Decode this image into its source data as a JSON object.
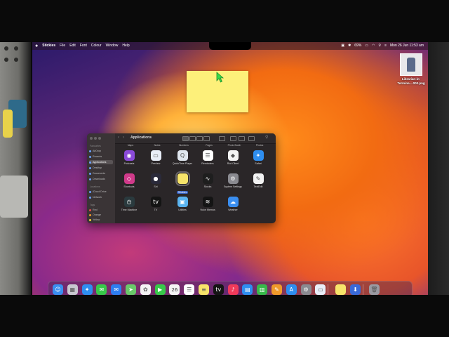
{
  "menubar": {
    "app_name": "Stickies",
    "menus": [
      "File",
      "Edit",
      "Font",
      "Colour",
      "Window",
      "Help"
    ],
    "battery": "69%",
    "datetime": "Mon 26 Jun  11:53 am"
  },
  "desktop_file": {
    "name": "Librarian-in-Termina....000.png"
  },
  "finder": {
    "title": "Applications",
    "sidebar": {
      "favourites_heading": "Favourites",
      "favourites": [
        "AirDrop",
        "Recents",
        "Applications",
        "Desktop",
        "Documents",
        "Downloads"
      ],
      "locations_heading": "Locations",
      "locations": [
        "iCloud Drive",
        "Network"
      ],
      "tags_heading": "Tags",
      "tags": [
        "Red",
        "Orange",
        "Yellow"
      ]
    },
    "column_headers": [
      "Maps",
      "Notes",
      "Numbers",
      "Pages",
      "Photo Booth",
      "Photos"
    ],
    "apps": [
      {
        "label": "Podcasts",
        "color": "#8a4ad8",
        "glyph": "◉"
      },
      {
        "label": "Preview",
        "color": "#e8eef8",
        "glyph": "▭"
      },
      {
        "label": "QuickTime Player",
        "color": "#dfe6ee",
        "glyph": "Q"
      },
      {
        "label": "Reminders",
        "color": "#ffffff",
        "glyph": "☰"
      },
      {
        "label": "Riot Client",
        "color": "#f4f4f4",
        "glyph": "◆"
      },
      {
        "label": "Safari",
        "color": "#2e8ef0",
        "glyph": "✦"
      },
      {
        "label": "Shortcuts",
        "color": "#d03a8a",
        "glyph": "◇"
      },
      {
        "label": "Siri",
        "color": "#2a2a3a",
        "glyph": "●"
      },
      {
        "label": "Stickies",
        "color": "#f7e46a",
        "glyph": ""
      },
      {
        "label": "Stocks",
        "color": "#1e1e1e",
        "glyph": "∿"
      },
      {
        "label": "System Settings",
        "color": "#8a8a90",
        "glyph": "⚙"
      },
      {
        "label": "TextEdit",
        "color": "#f2f2f2",
        "glyph": "✎"
      },
      {
        "label": "Time Machine",
        "color": "#2a3a3e",
        "glyph": "◷"
      },
      {
        "label": "TV",
        "color": "#141414",
        "glyph": "tv"
      },
      {
        "label": "Utilities",
        "color": "#5ab4f0",
        "glyph": "▣"
      },
      {
        "label": "Voice Memos",
        "color": "#141414",
        "glyph": "≋"
      },
      {
        "label": "Weather",
        "color": "#3a8ef0",
        "glyph": "☁"
      }
    ]
  },
  "dock": {
    "items": [
      {
        "name": "finder",
        "color": "#3a8ef0",
        "glyph": "☺"
      },
      {
        "name": "launchpad",
        "color": "#c8c8d0",
        "glyph": "▦"
      },
      {
        "name": "safari",
        "color": "#2e8ef0",
        "glyph": "✦"
      },
      {
        "name": "messages",
        "color": "#38c84a",
        "glyph": "✉"
      },
      {
        "name": "mail",
        "color": "#2e7ef0",
        "glyph": "✉"
      },
      {
        "name": "maps",
        "color": "#6ac86a",
        "glyph": "➤"
      },
      {
        "name": "photos",
        "color": "#f4f4f4",
        "glyph": "✿"
      },
      {
        "name": "facetime",
        "color": "#38c84a",
        "glyph": "▶"
      },
      {
        "name": "calendar",
        "color": "#f4f4f4",
        "glyph": "26"
      },
      {
        "name": "reminders",
        "color": "#ffffff",
        "glyph": "☰"
      },
      {
        "name": "notes",
        "color": "#f7e46a",
        "glyph": "≡"
      },
      {
        "name": "tv",
        "color": "#141414",
        "glyph": "tv"
      },
      {
        "name": "music",
        "color": "#f03a5a",
        "glyph": "♪"
      },
      {
        "name": "keynote",
        "color": "#2e8ef0",
        "glyph": "▤"
      },
      {
        "name": "numbers",
        "color": "#38b84a",
        "glyph": "▥"
      },
      {
        "name": "pages",
        "color": "#f09a2a",
        "glyph": "✎"
      },
      {
        "name": "app-store",
        "color": "#2e8ef0",
        "glyph": "A"
      },
      {
        "name": "system-settings",
        "color": "#8a8a90",
        "glyph": "⚙"
      },
      {
        "name": "preview",
        "color": "#e8eef8",
        "glyph": "▭"
      },
      {
        "name": "stickies",
        "color": "#f7e46a",
        "glyph": ""
      },
      {
        "name": "downloads",
        "color": "#3a6ad8",
        "glyph": "⬇"
      },
      {
        "name": "trash",
        "color": "#9a9aa2",
        "glyph": "🗑"
      }
    ]
  }
}
